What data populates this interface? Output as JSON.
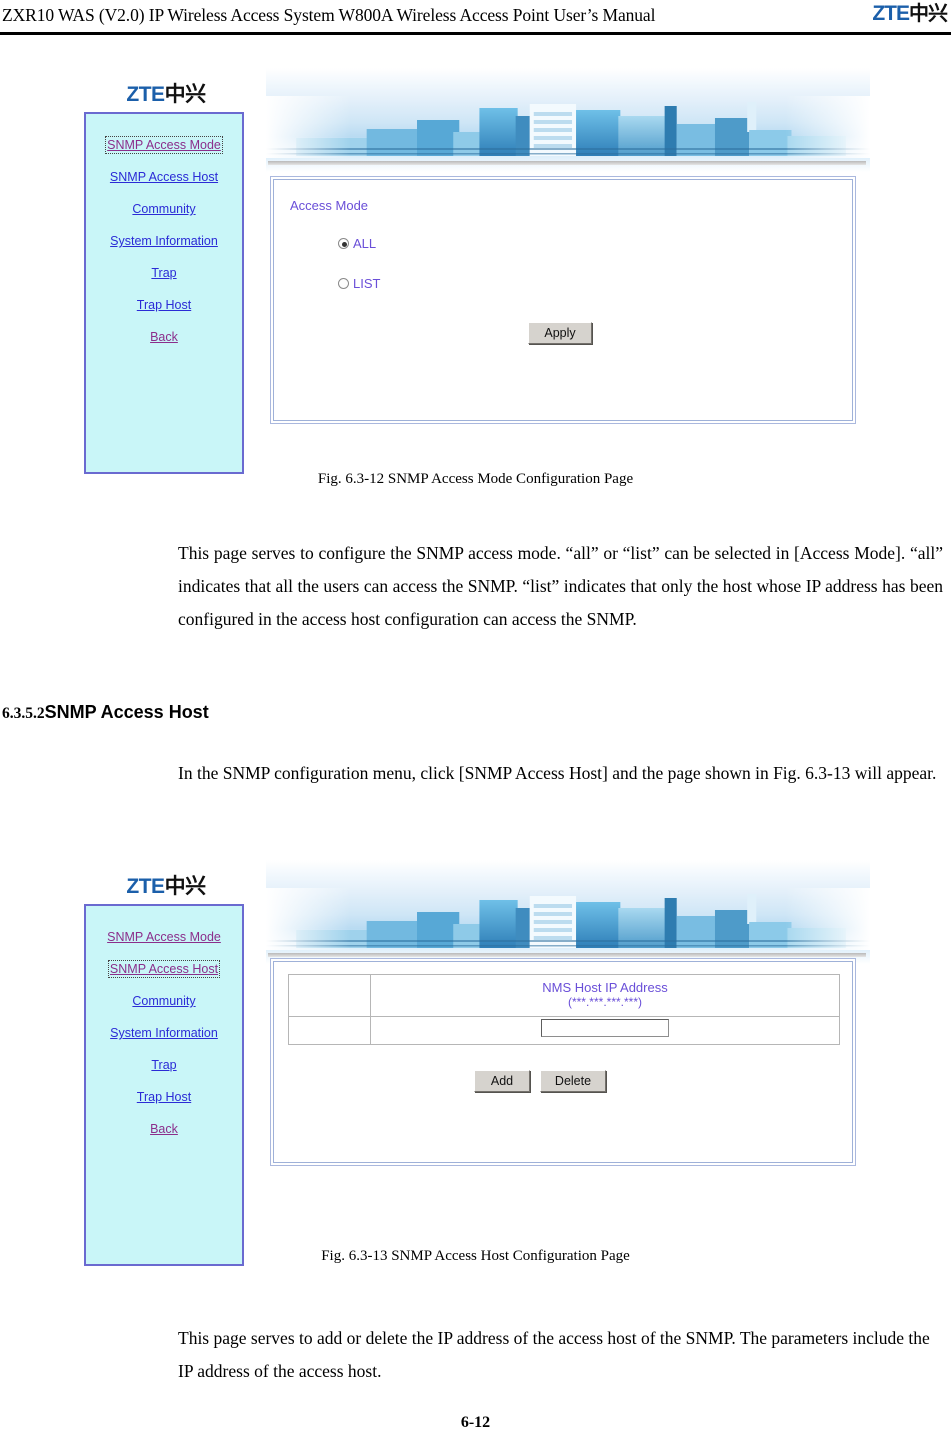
{
  "header": {
    "title": "ZXR10 WAS (V2.0) IP Wireless Access System W800A Wireless Access Point User’s Manual",
    "logo_mark": "ZTE",
    "logo_cn": "中兴"
  },
  "figure1": {
    "caption": "Fig. 6.3-12    SNMP Access Mode Configuration Page",
    "logo_mark": "ZTE",
    "logo_cn": "中兴",
    "nav_items": [
      {
        "label": "SNMP Access Mode",
        "state": "visited-focused"
      },
      {
        "label": "SNMP Access Host",
        "state": "link"
      },
      {
        "label": "Community",
        "state": "link"
      },
      {
        "label": "System Information",
        "state": "link"
      },
      {
        "label": "Trap",
        "state": "link"
      },
      {
        "label": "Trap Host",
        "state": "link"
      },
      {
        "label": "Back",
        "state": "visited"
      }
    ],
    "panel_label": "Access Mode",
    "options": [
      {
        "label": "ALL",
        "checked": true
      },
      {
        "label": "LIST",
        "checked": false
      }
    ],
    "apply_label": "Apply"
  },
  "figure2": {
    "caption": "Fig. 6.3-13    SNMP Access Host Configuration Page",
    "logo_mark": "ZTE",
    "logo_cn": "中兴",
    "nav_items": [
      {
        "label": "SNMP Access Mode",
        "state": "visited"
      },
      {
        "label": "SNMP Access Host",
        "state": "visited-focused"
      },
      {
        "label": "Community",
        "state": "link"
      },
      {
        "label": "System Information",
        "state": "link"
      },
      {
        "label": "Trap",
        "state": "link"
      },
      {
        "label": "Trap Host",
        "state": "link"
      },
      {
        "label": "Back",
        "state": "visited"
      }
    ],
    "table": {
      "header_title": "NMS Host IP Address",
      "header_mask": "(***.***.***.***)",
      "blank_header_cell": "",
      "blank_row_cell": "",
      "ip_value": ""
    },
    "add_label": "Add",
    "delete_label": "Delete"
  },
  "paragraphs": {
    "p1": "This page serves to configure the SNMP access mode. “all” or “list” can be selected in [Access Mode]. “all” indicates that all the users can access the SNMP. “list” indicates that only the host whose IP address has been configured in the access host configuration can access the SNMP.",
    "p2": "In the SNMP configuration menu, click [SNMP Access Host] and the page shown in Fig. 6.3-13 will appear.",
    "p3": "This page serves to add or delete the IP address of the access host of the SNMP. The parameters include the IP address of the access host."
  },
  "section": {
    "number": "6.3.5.2",
    "title": "SNMP Access Host"
  },
  "footer": {
    "page_number": "6-12"
  },
  "colors": {
    "nav_background": "#c9f6f8",
    "nav_border": "#6a6ad0",
    "link": "#2b2bd6",
    "visited_link": "#8b2e8b",
    "field_label": "#6a4fd8",
    "logo_blue": "#1b5faa",
    "button_face": "#d6d3ce"
  }
}
